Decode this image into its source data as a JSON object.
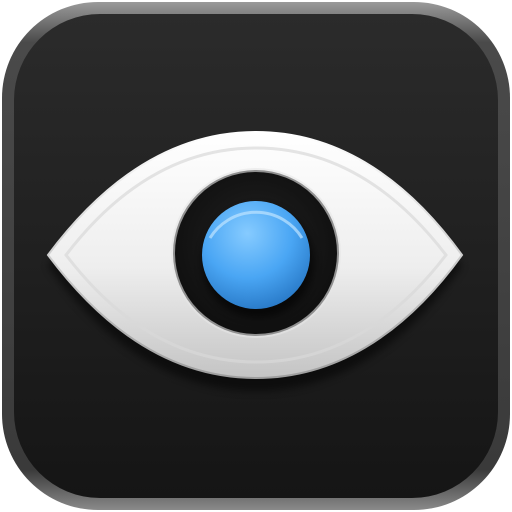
{
  "app_icon": {
    "name": "eye-app-icon",
    "depicts": "eye-icon",
    "colors": {
      "bezel_outer": "#3a3a3a",
      "bezel_highlight": "#8a8a8a",
      "background_top": "#2a2a2a",
      "background_bottom": "#141414",
      "sclera_light": "#ffffff",
      "sclera_shade": "#bdbdbd",
      "iris_ring": "#161616",
      "pupil_light": "#7cc4ff",
      "pupil_mid": "#3f9ff2",
      "pupil_dark": "#1f6fb9"
    }
  }
}
